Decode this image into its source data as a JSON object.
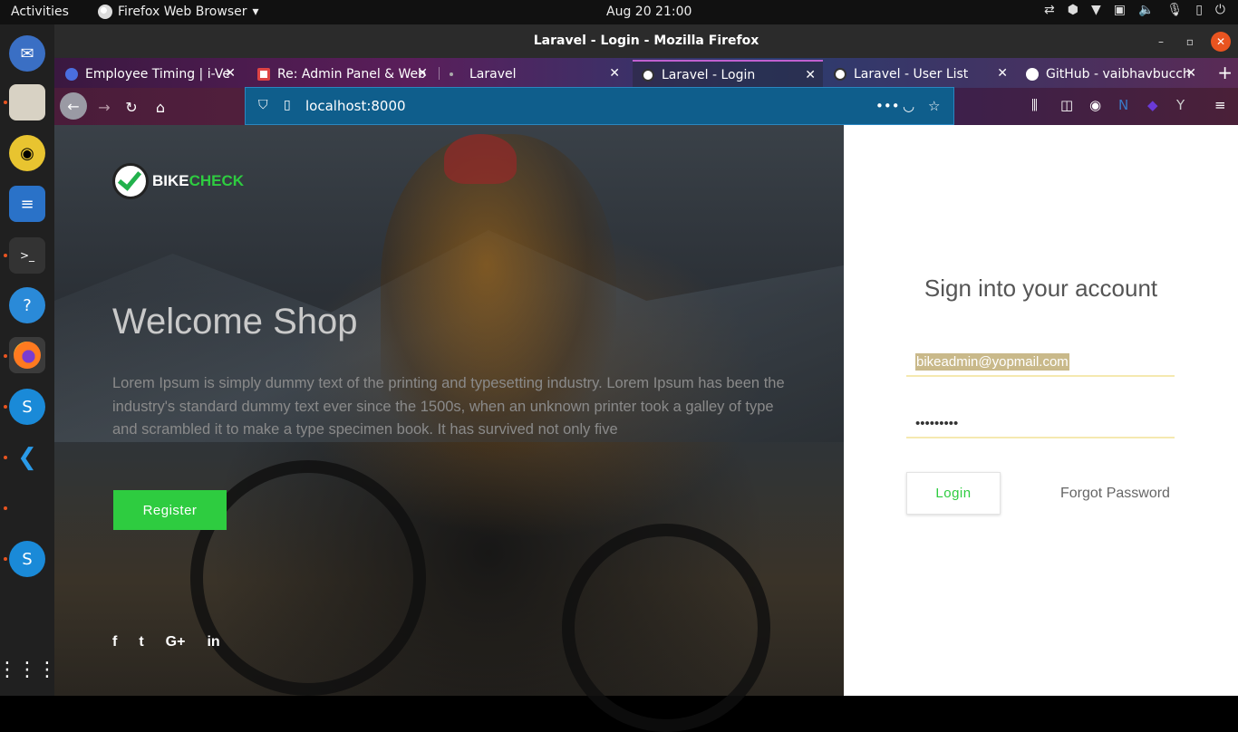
{
  "topbar": {
    "activities": "Activities",
    "app_menu": "Firefox Web Browser",
    "clock": "Aug 20  21:00"
  },
  "window": {
    "title": "Laravel - Login - Mozilla Firefox"
  },
  "tabs": [
    {
      "label": "Employee Timing | i-Ve",
      "icon": "firefox-icon"
    },
    {
      "label": "Re: Admin Panel & Web",
      "icon": "gmail-icon"
    },
    {
      "label": "Laravel",
      "icon": "dot-icon"
    },
    {
      "label": "Laravel - Login",
      "icon": "bikecheck-icon",
      "active": true
    },
    {
      "label": "Laravel - User List",
      "icon": "bikecheck-icon"
    },
    {
      "label": "GitHub - vaibhavbucch",
      "icon": "github-icon"
    }
  ],
  "urlbar": {
    "url": "localhost:8000"
  },
  "hero": {
    "brand_part1": "BIKE",
    "brand_part2": "CHECK",
    "title": "Welcome Shop",
    "text": "Lorem Ipsum is simply dummy text of the printing and typesetting industry. Lorem Ipsum has been the industry's standard dummy text ever since the 1500s, when an unknown printer took a galley of type and scrambled it to make a type specimen book. It has survived not only five",
    "register_label": "Register",
    "social": [
      "f",
      "t",
      "G+",
      "in"
    ]
  },
  "login": {
    "title": "Sign into your account",
    "email_value": "bikeadmin@yopmail.com",
    "password_value": "•••••••••",
    "login_label": "Login",
    "forgot_label": "Forgot Password"
  },
  "colors": {
    "accent_green": "#2ecc40",
    "url_bar": "#0f5e8c",
    "ubuntu_orange": "#e95420"
  }
}
